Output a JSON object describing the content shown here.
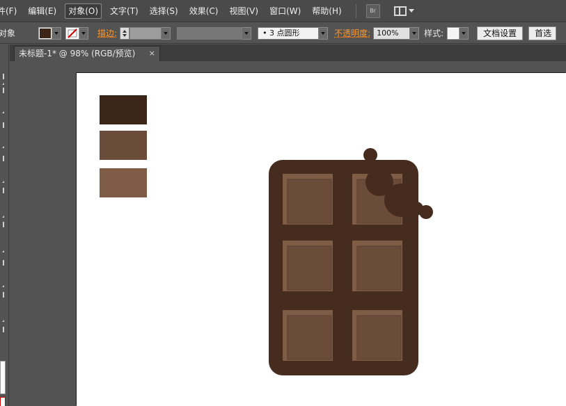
{
  "menu": {
    "items": [
      {
        "key": "file",
        "label": "件(F)"
      },
      {
        "key": "edit",
        "label": "编辑(E)"
      },
      {
        "key": "object",
        "label": "对象(O)"
      },
      {
        "key": "type",
        "label": "文字(T)"
      },
      {
        "key": "select",
        "label": "选择(S)"
      },
      {
        "key": "effect",
        "label": "效果(C)"
      },
      {
        "key": "view",
        "label": "视图(V)"
      },
      {
        "key": "window",
        "label": "窗口(W)"
      },
      {
        "key": "help",
        "label": "帮助(H)"
      }
    ],
    "active": "object",
    "bridge_label": "Br"
  },
  "control_bar": {
    "selection_label": "对象",
    "stroke_label": "描边:",
    "brush_label": "•  3 点圆形",
    "opacity_label": "不透明度:",
    "opacity_value": "100%",
    "style_label": "样式:",
    "doc_setup_label": "文档设置",
    "prefs_label": "首选",
    "fill_color": "#3d2518"
  },
  "document_tab": {
    "title": "未标题-1* @ 98% (RGB/预览)",
    "close_glyph": "×"
  },
  "color_samples": [
    "#3b2418",
    "#6b4c3b",
    "#7f5c45"
  ],
  "artwork": {
    "bar_color": "#452c1f",
    "piece_color": "#6b4c3b",
    "highlight_color": "#7f5c45",
    "piece_edge_color": "#5a3e2f",
    "background": "#ffffff"
  }
}
